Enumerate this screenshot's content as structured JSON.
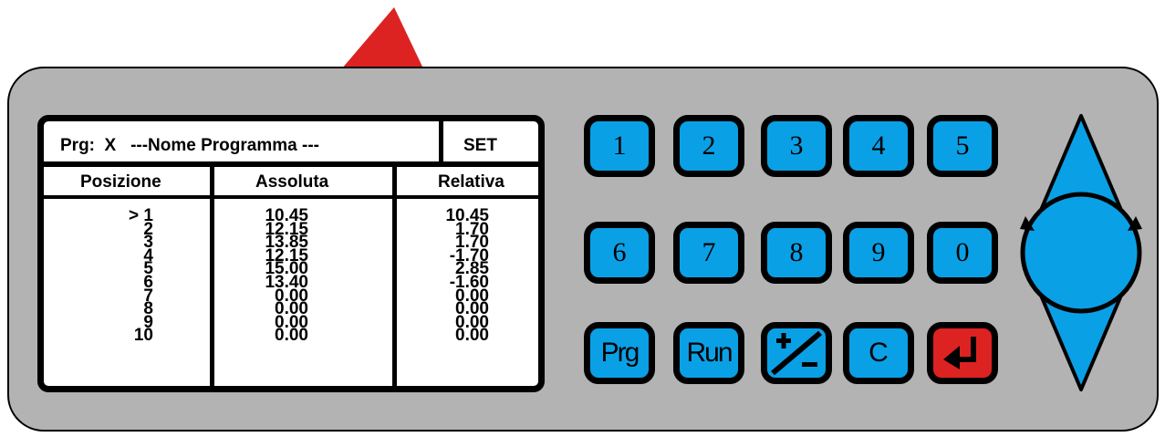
{
  "display": {
    "program_label": "Prg:  X   ---Nome Programma ---",
    "set_label": "SET",
    "headers": {
      "position": "Posizione",
      "absolute": "Assoluta",
      "relative": "Relativa"
    },
    "positions": "> 1\n2\n3\n4\n5\n6\n7\n8\n9\n10",
    "absolute": "10.45\n12.15\n13.85\n12.15\n15.00\n13.40\n0.00\n0.00\n0.00\n0.00",
    "relative": "10.45\n1.70\n1.70\n-1.70\n2.85\n-1.60\n0.00\n0.00\n0.00\n0.00"
  },
  "keypad": {
    "row1": [
      "1",
      "2",
      "3",
      "4",
      "5"
    ],
    "row2": [
      "6",
      "7",
      "8",
      "9",
      "0"
    ],
    "row3": {
      "prg": "Prg",
      "run": "Run",
      "clear": "C"
    }
  },
  "colors": {
    "key": "#0aa0e6",
    "enter": "#dd2222",
    "panel": "#b3b3b3",
    "pointer": "#dd2222"
  }
}
